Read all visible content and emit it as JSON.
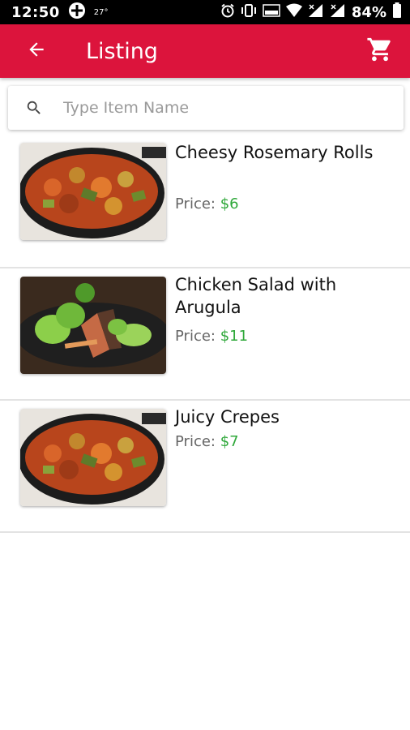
{
  "status_bar": {
    "time": "12:50",
    "temperature": "27°",
    "battery": "84%"
  },
  "app_bar": {
    "title": "Listing"
  },
  "search": {
    "placeholder": "Type Item Name"
  },
  "items": [
    {
      "name": "Cheesy Rosemary Rolls",
      "price_label": "Price:",
      "price": "$6",
      "image": "curry-dish"
    },
    {
      "name": "Chicken Salad with Arugula",
      "price_label": "Price:",
      "price": "$11",
      "image": "salad-dish"
    },
    {
      "name": "Juicy Crepes",
      "price_label": "Price:",
      "price": "$7",
      "image": "curry-dish"
    }
  ],
  "colors": {
    "primary": "#dc143c",
    "price": "#2fa83a",
    "divider": "#e3e3e3"
  }
}
